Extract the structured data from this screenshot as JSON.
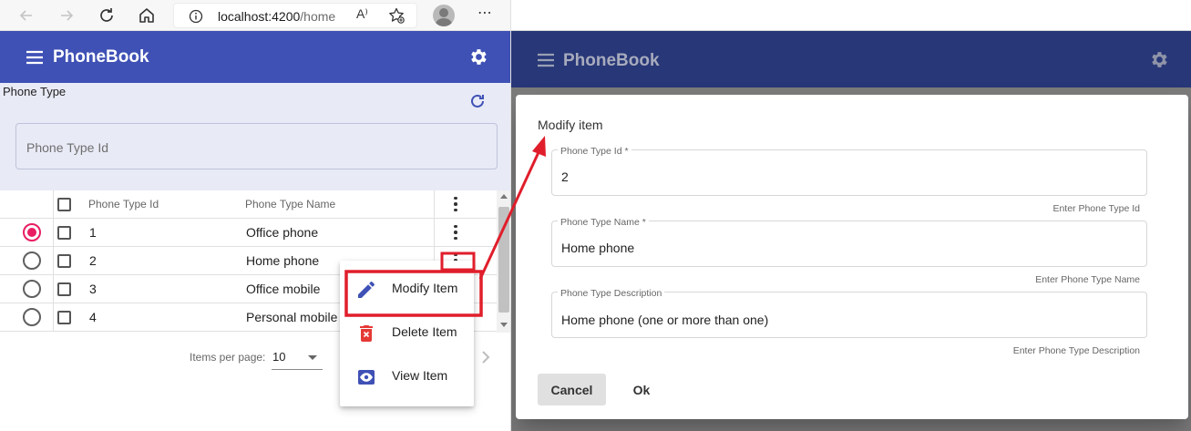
{
  "browser": {
    "url_host": "localhost:4200",
    "url_path": "/home",
    "read_aloud_label": "A⁾",
    "more_label": "⋯"
  },
  "app": {
    "title": "PhoneBook"
  },
  "filter": {
    "title": "Phone Type",
    "search_placeholder": "Phone Type Id"
  },
  "table": {
    "columns": [
      "Phone Type Id",
      "Phone Type Name"
    ],
    "rows": [
      {
        "id": "1",
        "name": "Office phone",
        "selected": true
      },
      {
        "id": "2",
        "name": "Home phone",
        "selected": false
      },
      {
        "id": "3",
        "name": "Office mobile",
        "selected": false
      },
      {
        "id": "4",
        "name": "Personal mobile",
        "selected": false
      }
    ]
  },
  "paginator": {
    "items_per_page_label": "Items per page:",
    "items_per_page_value": "10"
  },
  "context_menu": {
    "items": [
      {
        "label": "Modify Item",
        "icon": "pencil-icon"
      },
      {
        "label": "Delete Item",
        "icon": "trash-icon"
      },
      {
        "label": "View Item",
        "icon": "eye-icon"
      }
    ]
  },
  "dialog": {
    "title": "Modify item",
    "fields": [
      {
        "label": "Phone Type Id *",
        "value": "2",
        "hint": "Enter Phone Type Id"
      },
      {
        "label": "Phone Type Name *",
        "value": "Home phone",
        "hint": "Enter Phone Type Name"
      },
      {
        "label": "Phone Type Description",
        "value": "Home phone (one or more than one)",
        "hint": "Enter Phone Type Description"
      }
    ],
    "cancel_label": "Cancel",
    "ok_label": "Ok"
  },
  "colors": {
    "primary": "#3f51b5",
    "primary_dimmed": "#283777",
    "filter_bg": "#e8eaf6",
    "radio_selected": "#e91e63",
    "delete_icon": "#e53935",
    "annotation_red": "#e01e2b"
  }
}
